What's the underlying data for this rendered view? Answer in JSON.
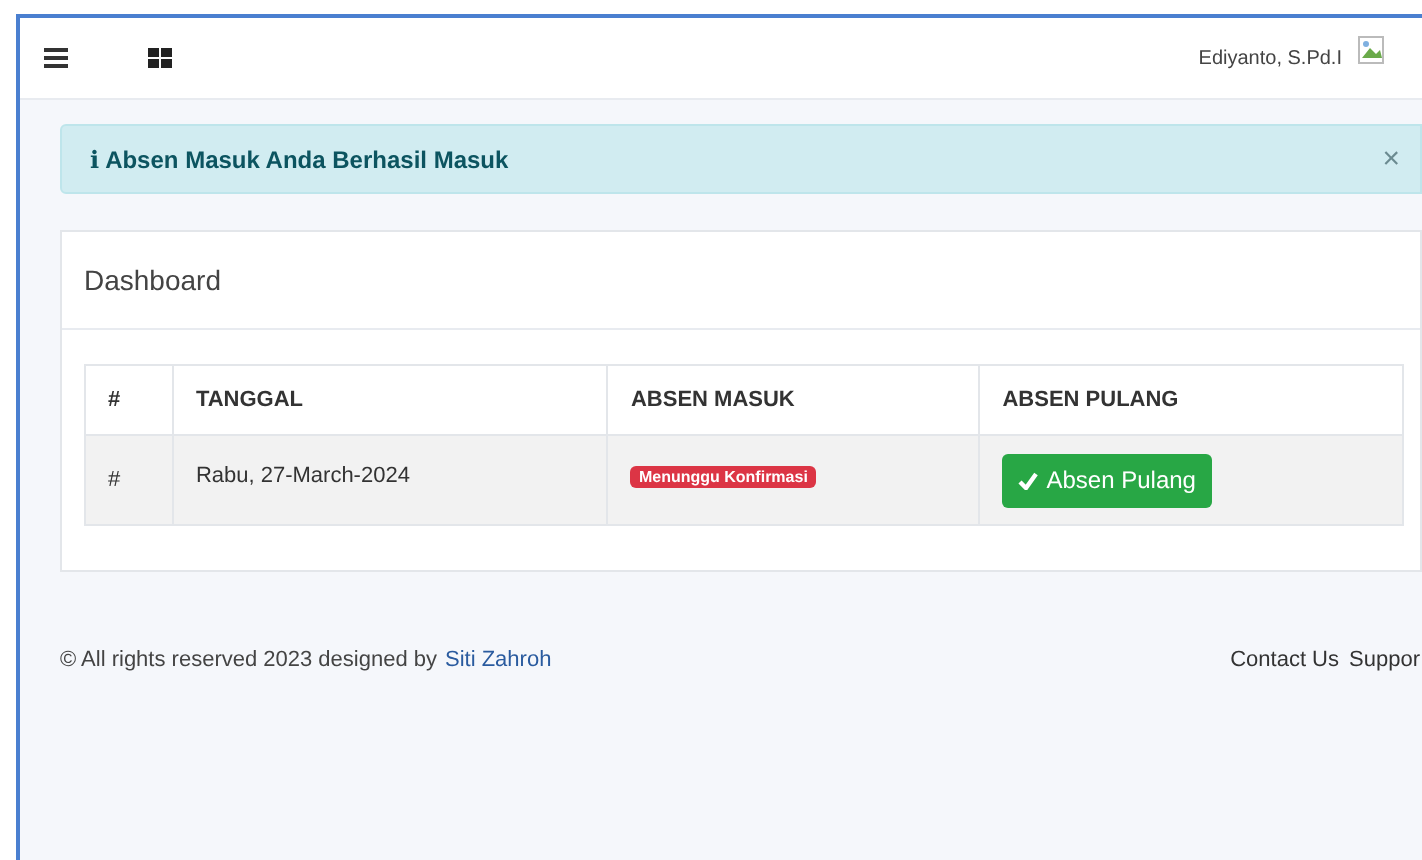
{
  "navbar": {
    "user_name": "Ediyanto, S.Pd.I"
  },
  "alert": {
    "icon": "i",
    "message": "Absen Masuk Anda Berhasil Masuk",
    "close": "×"
  },
  "card": {
    "title": "Dashboard",
    "table": {
      "columns": [
        "#",
        "TANGGAL",
        "ABSEN MASUK",
        "ABSEN PULANG"
      ],
      "rows": [
        {
          "number": "#",
          "date": "Rabu, 27-March-2024",
          "status": "Menunggu Konfirmasi",
          "action": "Absen Pulang"
        }
      ]
    }
  },
  "footer": {
    "copyright": "© All rights reserved 2023 designed by",
    "author": "Siti Zahroh",
    "links": [
      "Contact Us",
      "Suppor"
    ]
  }
}
